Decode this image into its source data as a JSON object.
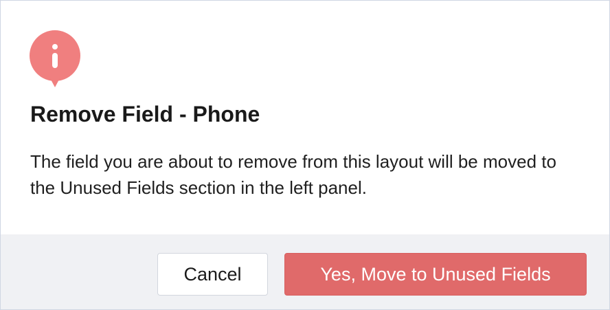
{
  "dialog": {
    "icon": "info-icon",
    "title": "Remove Field - Phone",
    "message": "The field you are about to remove from this layout will be moved to the Unused Fields section in the left panel.",
    "cancel_label": "Cancel",
    "confirm_label": "Yes, Move to Unused Fields"
  },
  "colors": {
    "accent": "#e06a6a",
    "icon": "#f07f7f",
    "footer_bg": "#f0f1f4"
  }
}
